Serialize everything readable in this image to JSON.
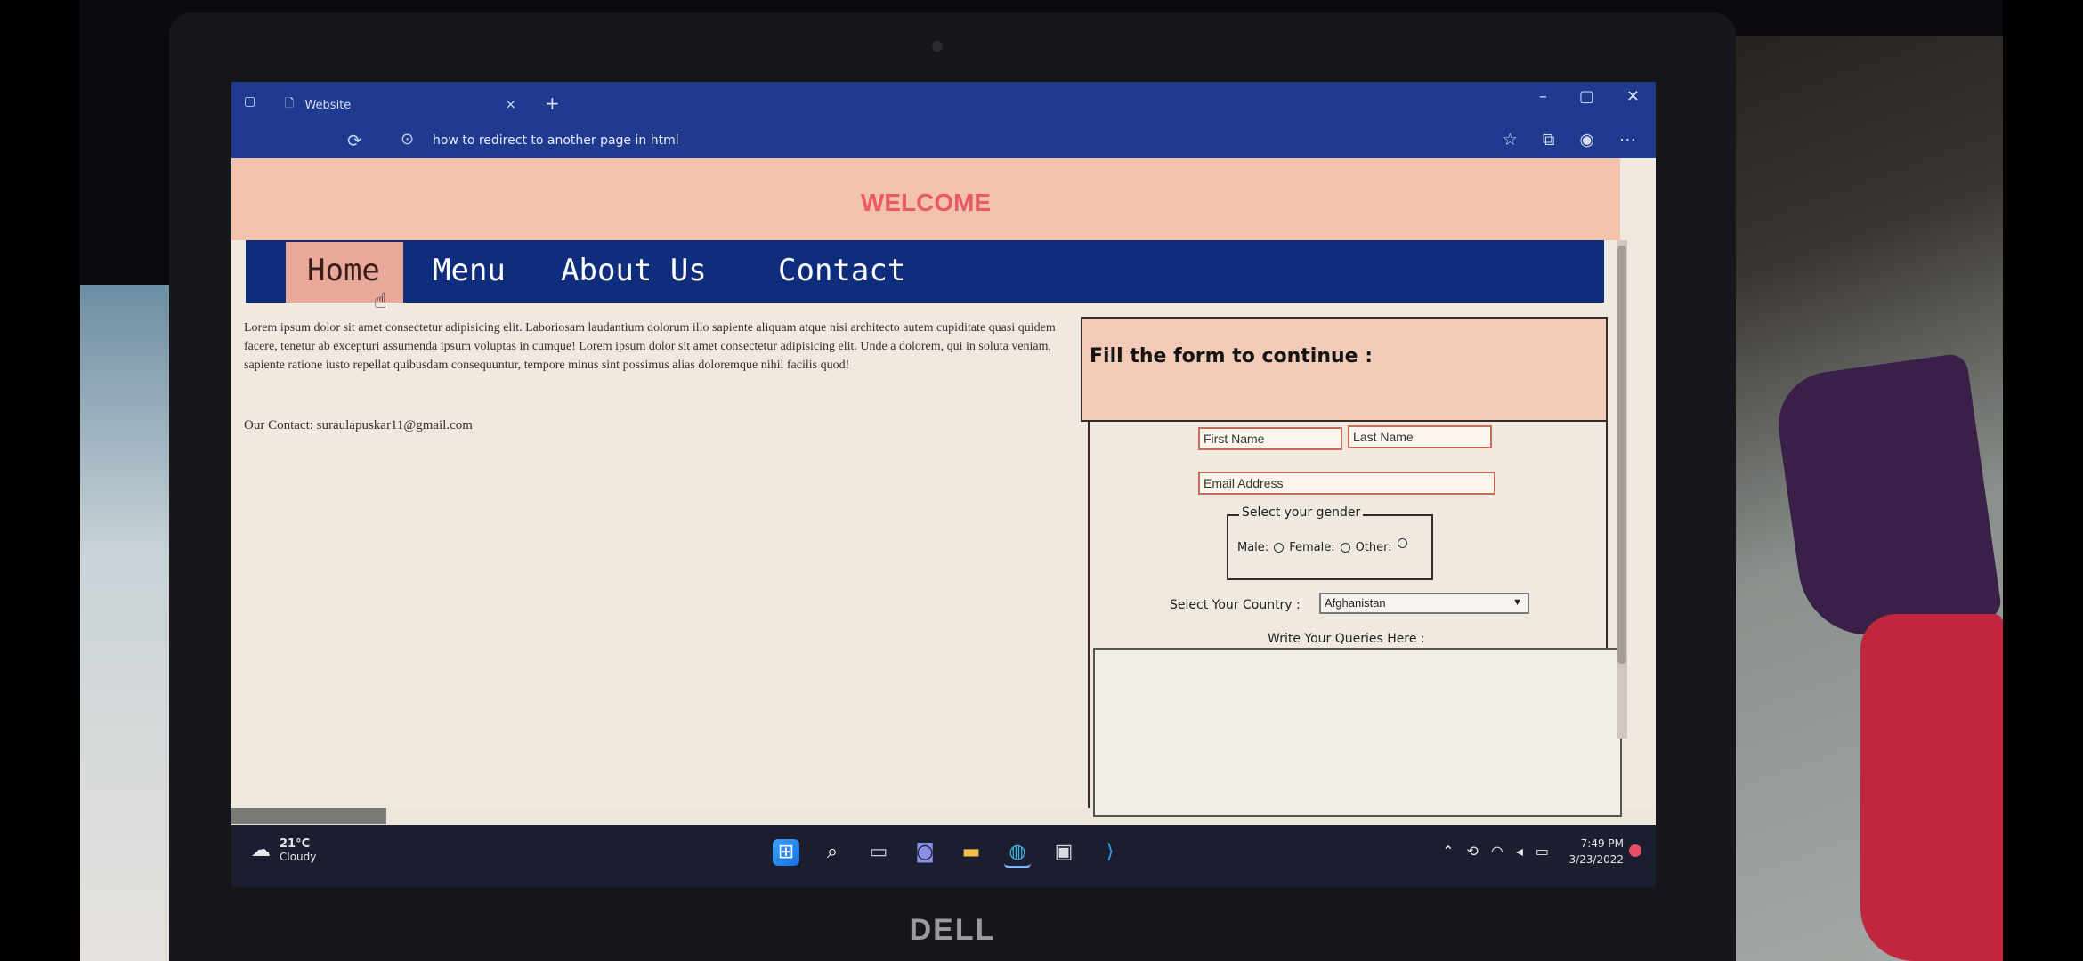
{
  "browser": {
    "tab_title": "Website",
    "tab_close": "×",
    "new_tab": "+",
    "address": "how to redirect to another page in html",
    "window_controls": [
      "–",
      "▢",
      "✕"
    ],
    "toolbar_icons": [
      "star-icon",
      "collections-icon",
      "profile-icon",
      "more-icon"
    ]
  },
  "page": {
    "welcome": "WELCOME",
    "nav": [
      "Home",
      "Menu",
      "About Us",
      "Contact"
    ],
    "lorem": "Lorem ipsum dolor sit amet consectetur adipisicing elit. Laboriosam laudantium dolorum illo sapiente aliquam atque nisi architecto autem cupiditate quasi quidem facere, tenetur ab excepturi assumenda ipsum voluptas in cumque! Lorem ipsum dolor sit amet consectetur adipisicing elit. Unde a dolorem, qui in soluta veniam, sapiente ratione iusto repellat quibusdam consequuntur, tempore minus sint possimus alias doloremque nihil facilis quod!",
    "contact": "Our Contact: suraulapuskar11@gmail.com"
  },
  "form": {
    "title": "Fill the form to continue :",
    "first_name_placeholder": "First Name",
    "last_name_placeholder": "Last Name",
    "email_placeholder": "Email Address",
    "gender_legend": "Select your gender",
    "gender_options": [
      "Male:",
      "Female:",
      "Other:"
    ],
    "country_label": "Select Your Country :",
    "country_selected": "Afghanistan",
    "queries_label": "Write Your Queries Here :"
  },
  "taskbar": {
    "weather_temp": "21°C",
    "weather_cond": "Cloudy",
    "time": "7:49 PM",
    "date": "3/23/2022"
  },
  "device": {
    "brand": "DELL"
  }
}
